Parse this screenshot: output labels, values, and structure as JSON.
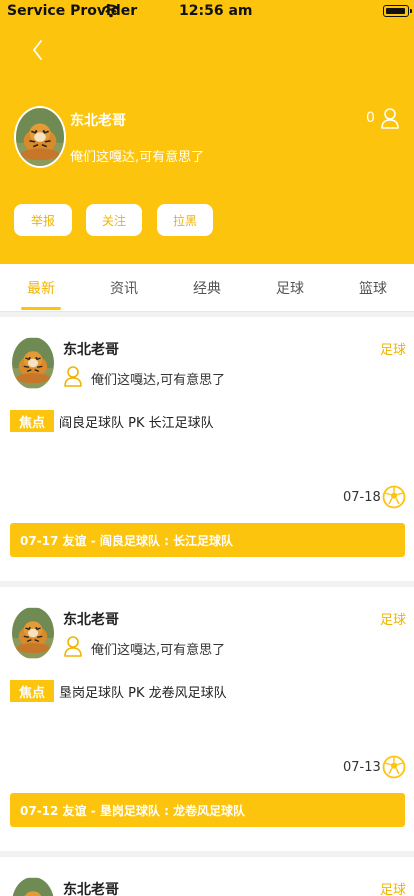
{
  "status_bar": {
    "carrier": "Service Provider",
    "time": "12:56 am"
  },
  "profile": {
    "name": "东北老哥",
    "bio": "俺们这嘎达,可有意思了",
    "follower_count": "0",
    "actions": {
      "report": "举报",
      "follow": "关注",
      "block": "拉黑"
    }
  },
  "tabs": [
    "最新",
    "资讯",
    "经典",
    "足球",
    "篮球"
  ],
  "active_tab": "最新",
  "posts": [
    {
      "author": "东北老哥",
      "bio": "俺们这嘎达,可有意思了",
      "sport": "足球",
      "badge": "焦点",
      "match": "阎良足球队 PK 长江足球队",
      "date": "07-18",
      "history": "07-17 友谊 - 阎良足球队 : 长江足球队"
    },
    {
      "author": "东北老哥",
      "bio": "俺们这嘎达,可有意思了",
      "sport": "足球",
      "badge": "焦点",
      "match": "垦岗足球队 PK 龙卷风足球队",
      "date": "07-13",
      "history": "07-12 友谊 - 垦岗足球队 : 龙卷风足球队"
    },
    {
      "author": "东北老哥",
      "sport": "足球"
    }
  ],
  "colors": {
    "brand": "#fcc40c",
    "accent_text": "#f0b400"
  }
}
